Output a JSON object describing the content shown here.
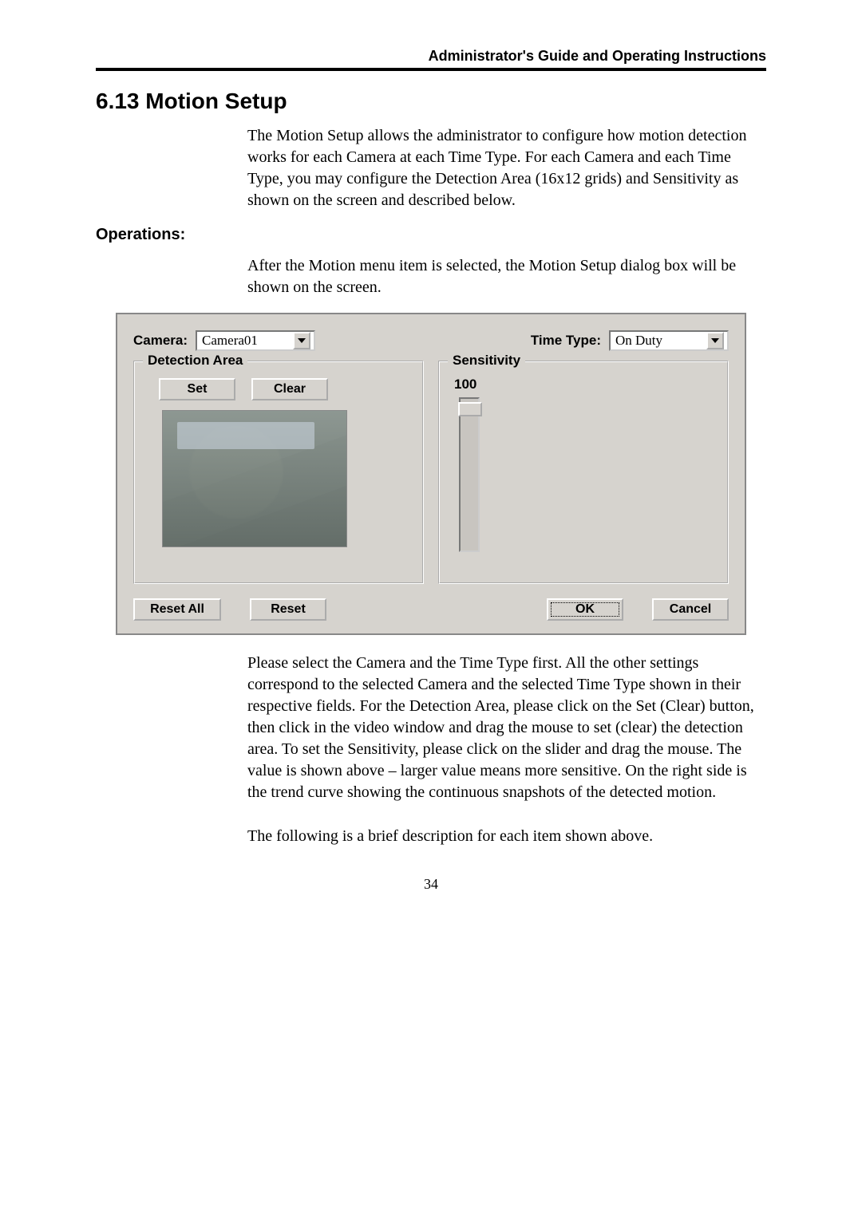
{
  "running_header": "Administrator's Guide and Operating Instructions",
  "section_title": "6.13 Motion Setup",
  "intro_paragraph": "The Motion Setup allows the administrator to configure how motion detection works for each Camera at each Time Type.   For each Camera and each Time Type, you may configure the Detection Area (16x12 grids) and Sensitivity as shown on the screen and described below.",
  "operations_heading": "Operations:",
  "operations_intro": "After the Motion menu item is selected, the Motion Setup dialog box will be shown on the screen.",
  "after_dialog_paragraph": "Please select the Camera and the Time Type first.   All the other settings correspond to the selected Camera and the selected Time Type shown in their respective fields.   For the Detection Area, please click on the Set (Clear) button, then click in the video window and drag the mouse to set (clear) the detection area.   To set the Sensitivity, please click on the slider and drag the mouse.   The value is shown above – larger value means more sensitive.   On the right side is the trend curve showing the continuous snapshots of the detected motion.",
  "closing_paragraph": "The following is a brief description for each item shown above.",
  "page_number": "34",
  "dialog": {
    "camera_label": "Camera:",
    "camera_value": "Camera01",
    "timetype_label": "Time Type:",
    "timetype_value": "On Duty",
    "detection_legend": "Detection Area",
    "sensitivity_legend": "Sensitivity",
    "sensitivity_value": "100",
    "buttons": {
      "set": "Set",
      "clear": "Clear",
      "reset_all": "Reset All",
      "reset": "Reset",
      "ok": "OK",
      "cancel": "Cancel"
    }
  }
}
